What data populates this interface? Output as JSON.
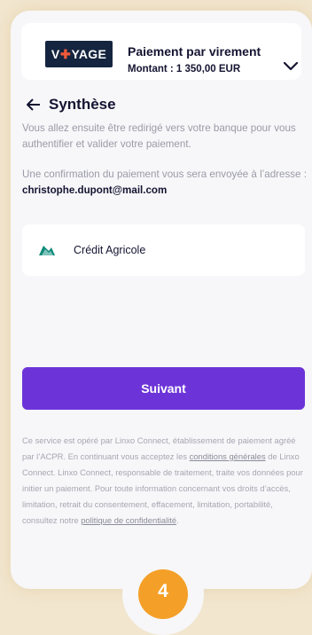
{
  "header": {
    "logo": {
      "before": "V",
      "after": "YAGE"
    },
    "title": "Paiement par virement",
    "amount": "Montant : 1 350,00 EUR"
  },
  "summary": {
    "title": "Synthèse",
    "redirect_text": "Vous allez ensuite être redirigé vers votre banque pour vous authentifier et valider votre paiement.",
    "confirm_text": "Une confirmation du paiement vous sera envoyée à l’adresse : ",
    "email": "christophe.dupont@mail.com"
  },
  "bank": {
    "name": "Crédit Agricole"
  },
  "cta": {
    "label": "Suivant"
  },
  "legal": {
    "part1": "Ce service est opéré par Linxo Connect, établissement de paiement agréé par l’ACPR. En continuant vous acceptez les ",
    "terms_link": "conditions générales",
    "part2": " de Linxo Connect. Linxo Connect, responsable de traitement, traite vos données pour initier un paiement. Pour toute information concernant vos droits d’accès, limitation, retrait du consentement, effacement, limitation, portabilité, consultez notre ",
    "privacy_link": "politique de confidentialité",
    "part3": "."
  },
  "step": {
    "number": "4"
  },
  "colors": {
    "primary": "#6c34d8",
    "accent": "#f4a028",
    "logo_bg": "#15253f",
    "logo_plus": "#f05a3a",
    "background": "#f2e6cf"
  }
}
